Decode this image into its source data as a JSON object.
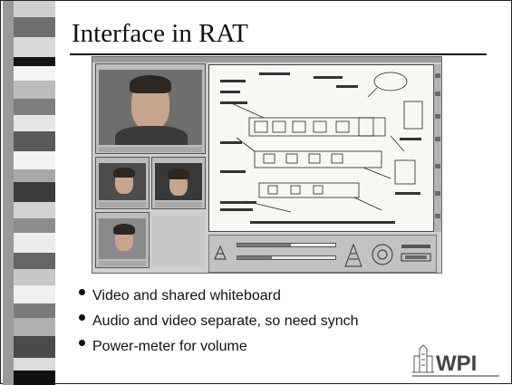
{
  "slide": {
    "title": "Interface in RAT",
    "bullets": [
      "Video and shared whiteboard",
      "Audio and video separate, so need synch",
      "Power-meter for volume"
    ]
  },
  "logo": {
    "text": "WPI",
    "icon": "wpi-tower-logo"
  },
  "screenshot": {
    "description_icon": "rat-application-screenshot",
    "input_meter_level": 0.55,
    "output_meter_level": 0.35
  },
  "colors": {
    "strip": "#9a9a9a",
    "text": "#111111",
    "logo": "#444444"
  }
}
